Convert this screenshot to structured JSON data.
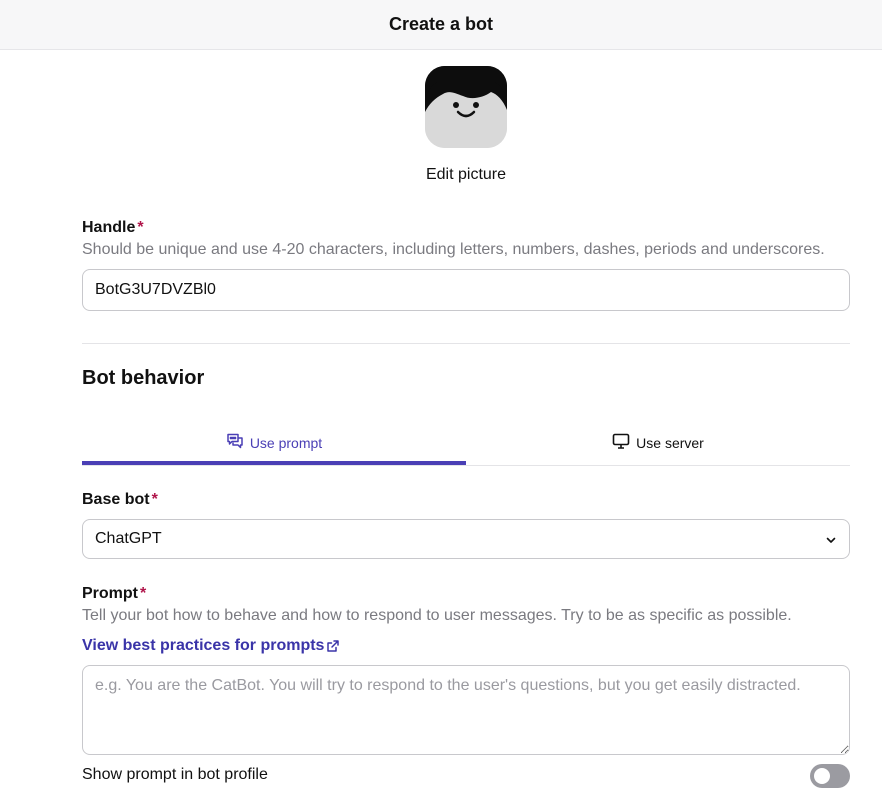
{
  "header": {
    "title": "Create a bot"
  },
  "avatar": {
    "icon": "face-avatar-icon",
    "edit_label": "Edit picture"
  },
  "handle": {
    "label": "Handle",
    "required_mark": "*",
    "hint": "Should be unique and use 4-20 characters, including letters, numbers, dashes, periods and underscores.",
    "value": "BotG3U7DVZBl0"
  },
  "behavior": {
    "title": "Bot behavior",
    "tabs": [
      {
        "label": "Use prompt",
        "icon": "chat-bubbles-icon",
        "active": true
      },
      {
        "label": "Use server",
        "icon": "monitor-icon",
        "active": false
      }
    ],
    "accent_color": "#4a3fb5"
  },
  "base_bot": {
    "label": "Base bot",
    "required_mark": "*",
    "value": "ChatGPT",
    "icon": "chevron-down-icon"
  },
  "prompt": {
    "label": "Prompt",
    "required_mark": "*",
    "hint": "Tell your bot how to behave and how to respond to user messages. Try to be as specific as possible.",
    "link": "View best practices for prompts",
    "link_icon": "external-link-icon",
    "placeholder": "e.g. You are the CatBot. You will try to respond to the user's questions, but you get easily distracted.",
    "value": ""
  },
  "show_prompt": {
    "label": "Show prompt in bot profile",
    "enabled": false
  }
}
